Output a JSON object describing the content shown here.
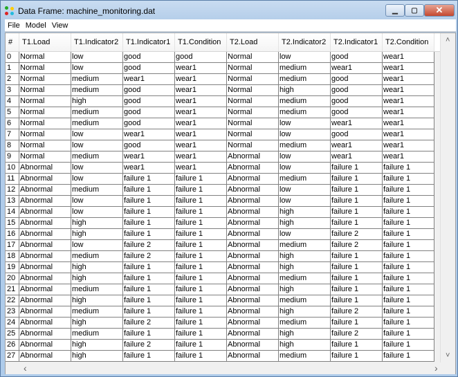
{
  "window": {
    "title": "Data Frame: machine_monitoring.dat",
    "minimize": "▁",
    "maximize": "▢",
    "close": "✕"
  },
  "menu": [
    "File",
    "Model",
    "View"
  ],
  "columns": [
    "#",
    "T1.Load",
    "T1.Indicator2",
    "T1.Indicator1",
    "T1.Condition",
    "T2.Load",
    "T2.Indicator2",
    "T2.Indicator1",
    "T2.Condition"
  ],
  "rows": [
    [
      "0",
      "Normal",
      "low",
      "good",
      "good",
      "Normal",
      "low",
      "good",
      "wear1"
    ],
    [
      "1",
      "Normal",
      "low",
      "good",
      "wear1",
      "Normal",
      "medium",
      "wear1",
      "wear1"
    ],
    [
      "2",
      "Normal",
      "medium",
      "wear1",
      "wear1",
      "Normal",
      "medium",
      "good",
      "wear1"
    ],
    [
      "3",
      "Normal",
      "medium",
      "good",
      "wear1",
      "Normal",
      "high",
      "good",
      "wear1"
    ],
    [
      "4",
      "Normal",
      "high",
      "good",
      "wear1",
      "Normal",
      "medium",
      "good",
      "wear1"
    ],
    [
      "5",
      "Normal",
      "medium",
      "good",
      "wear1",
      "Normal",
      "medium",
      "good",
      "wear1"
    ],
    [
      "6",
      "Normal",
      "medium",
      "good",
      "wear1",
      "Normal",
      "low",
      "wear1",
      "wear1"
    ],
    [
      "7",
      "Normal",
      "low",
      "wear1",
      "wear1",
      "Normal",
      "low",
      "good",
      "wear1"
    ],
    [
      "8",
      "Normal",
      "low",
      "good",
      "wear1",
      "Normal",
      "medium",
      "wear1",
      "wear1"
    ],
    [
      "9",
      "Normal",
      "medium",
      "wear1",
      "wear1",
      "Abnormal",
      "low",
      "wear1",
      "wear1"
    ],
    [
      "10",
      "Abnormal",
      "low",
      "wear1",
      "wear1",
      "Abnormal",
      "low",
      "failure 1",
      "failure 1"
    ],
    [
      "11",
      "Abnormal",
      "low",
      "failure 1",
      "failure 1",
      "Abnormal",
      "medium",
      "failure 1",
      "failure 1"
    ],
    [
      "12",
      "Abnormal",
      "medium",
      "failure 1",
      "failure 1",
      "Abnormal",
      "low",
      "failure 1",
      "failure 1"
    ],
    [
      "13",
      "Abnormal",
      "low",
      "failure 1",
      "failure 1",
      "Abnormal",
      "low",
      "failure 1",
      "failure 1"
    ],
    [
      "14",
      "Abnormal",
      "low",
      "failure 1",
      "failure 1",
      "Abnormal",
      "high",
      "failure 1",
      "failure 1"
    ],
    [
      "15",
      "Abnormal",
      "high",
      "failure 1",
      "failure 1",
      "Abnormal",
      "high",
      "failure 1",
      "failure 1"
    ],
    [
      "16",
      "Abnormal",
      "high",
      "failure 1",
      "failure 1",
      "Abnormal",
      "low",
      "failure 2",
      "failure 1"
    ],
    [
      "17",
      "Abnormal",
      "low",
      "failure 2",
      "failure 1",
      "Abnormal",
      "medium",
      "failure 2",
      "failure 1"
    ],
    [
      "18",
      "Abnormal",
      "medium",
      "failure 2",
      "failure 1",
      "Abnormal",
      "high",
      "failure 1",
      "failure 1"
    ],
    [
      "19",
      "Abnormal",
      "high",
      "failure 1",
      "failure 1",
      "Abnormal",
      "high",
      "failure 1",
      "failure 1"
    ],
    [
      "20",
      "Abnormal",
      "high",
      "failure 1",
      "failure 1",
      "Abnormal",
      "medium",
      "failure 1",
      "failure 1"
    ],
    [
      "21",
      "Abnormal",
      "medium",
      "failure 1",
      "failure 1",
      "Abnormal",
      "high",
      "failure 1",
      "failure 1"
    ],
    [
      "22",
      "Abnormal",
      "high",
      "failure 1",
      "failure 1",
      "Abnormal",
      "medium",
      "failure 1",
      "failure 1"
    ],
    [
      "23",
      "Abnormal",
      "medium",
      "failure 1",
      "failure 1",
      "Abnormal",
      "high",
      "failure 2",
      "failure 1"
    ],
    [
      "24",
      "Abnormal",
      "high",
      "failure 2",
      "failure 1",
      "Abnormal",
      "medium",
      "failure 1",
      "failure 1"
    ],
    [
      "25",
      "Abnormal",
      "medium",
      "failure 1",
      "failure 1",
      "Abnormal",
      "high",
      "failure 2",
      "failure 1"
    ],
    [
      "26",
      "Abnormal",
      "high",
      "failure 2",
      "failure 1",
      "Abnormal",
      "high",
      "failure 1",
      "failure 1"
    ],
    [
      "27",
      "Abnormal",
      "high",
      "failure 1",
      "failure 1",
      "Abnormal",
      "medium",
      "failure 1",
      "failure 1"
    ]
  ],
  "scroll": {
    "up": "˄",
    "down": "˅",
    "left": "‹",
    "right": "›"
  }
}
